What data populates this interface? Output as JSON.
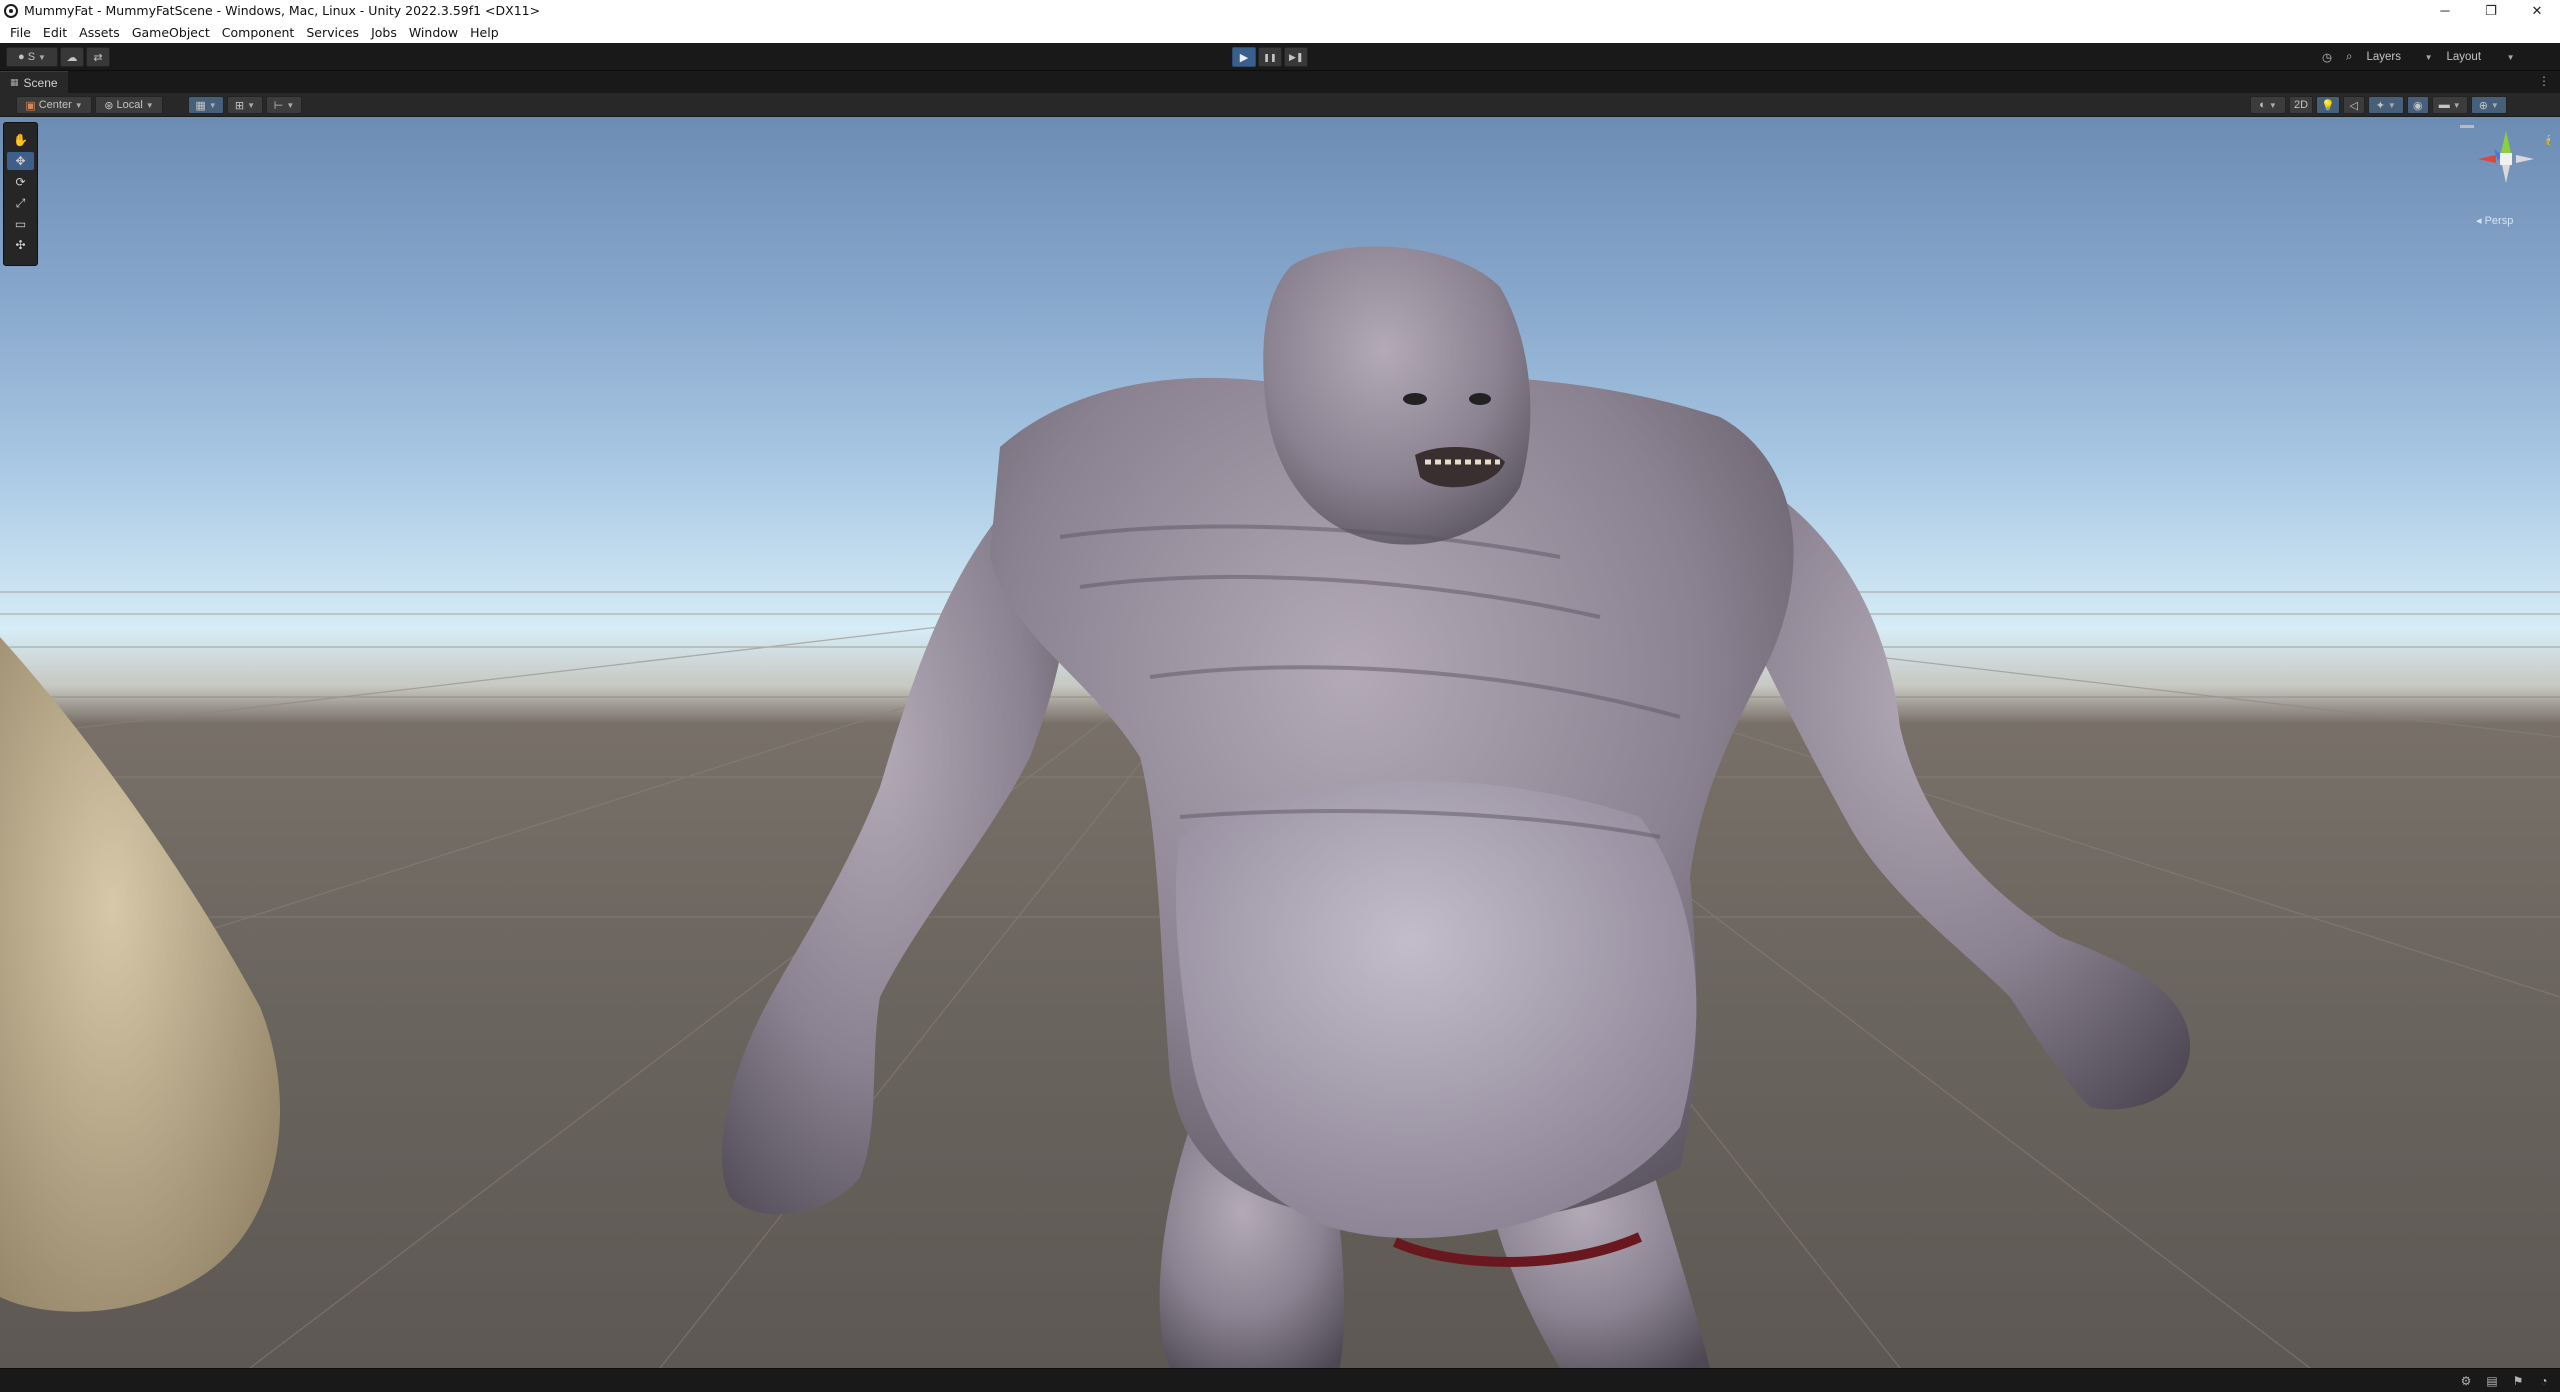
{
  "window": {
    "title": "MummyFat - MummyFatScene - Windows, Mac, Linux - Unity 2022.3.59f1 <DX11>",
    "controls": {
      "minimize": "─",
      "maximize": "❐",
      "close": "✕"
    }
  },
  "menu": [
    "File",
    "Edit",
    "Assets",
    "GameObject",
    "Component",
    "Services",
    "Jobs",
    "Window",
    "Help"
  ],
  "main_toolbar": {
    "account_label": "S",
    "play": "▶",
    "pause": "❚❚",
    "step": "▶❚",
    "layers_label": "Layers",
    "layout_label": "Layout"
  },
  "scene_tab": {
    "label": "Scene",
    "icon": "scene-grid-icon"
  },
  "scene_toolbar": {
    "pivot_label": "Center",
    "space_label": "Local",
    "two_d_label": "2D"
  },
  "tools": [
    {
      "name": "view-tool",
      "glyph": "✋"
    },
    {
      "name": "move-tool",
      "glyph": "✥"
    },
    {
      "name": "rotate-tool",
      "glyph": "⟳"
    },
    {
      "name": "scale-tool",
      "glyph": "⤢"
    },
    {
      "name": "rect-tool",
      "glyph": "▭"
    },
    {
      "name": "transform-tool",
      "glyph": "✣"
    }
  ],
  "gizmo": {
    "projection_label": "◂ Persp",
    "axis_colors": {
      "x": "#e0453b",
      "y": "#8ccf3f",
      "z": "#3d7be0"
    }
  },
  "colors": {
    "accent": "#3a5f8c",
    "editor_bg": "#191919",
    "panel_bg": "#282828"
  }
}
